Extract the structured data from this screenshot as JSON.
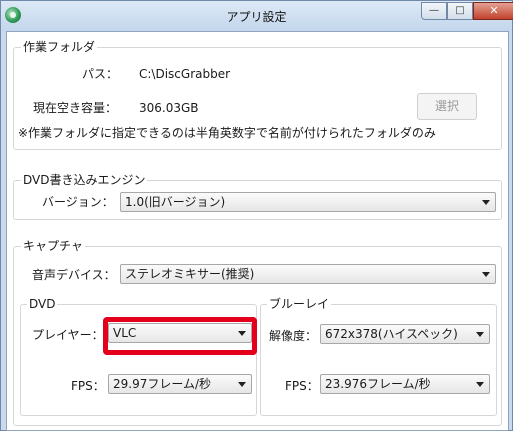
{
  "window": {
    "title": "アプリ設定",
    "min_label": "—",
    "max_label": "□",
    "close_label": "✕"
  },
  "work_folder": {
    "legend": "作業フォルダ",
    "path_label": "パス：",
    "path_value": "C:\\DiscGrabber",
    "space_label": "現在空き容量：",
    "space_value": "306.03GB",
    "select_button": "選択",
    "note": "※作業フォルダに指定できるのは半角英数字で名前が付けられたフォルダのみ"
  },
  "dvd_engine": {
    "legend": "DVD書き込みエンジン",
    "version_label": "バージョン：",
    "version_value": "1.0(旧バージョン)"
  },
  "capture": {
    "legend": "キャプチャ",
    "audio_label": "音声デバイス：",
    "audio_value": "ステレオミキサー(推奨)",
    "dvd": {
      "legend": "DVD",
      "player_label": "プレイヤー：",
      "player_value": "VLC",
      "fps_label": "FPS：",
      "fps_value": "29.97フレーム/秒"
    },
    "bluray": {
      "legend": "ブルーレイ",
      "resolution_label": "解像度：",
      "resolution_value": "672x378(ハイスペック)",
      "fps_label": "FPS：",
      "fps_value": "23.976フレーム/秒"
    }
  },
  "colors": {
    "highlight": "#e4001c",
    "close_button": "#c2422c"
  },
  "icons": {
    "app": "disc-grabber-app-icon",
    "dropdown": "chevron-down-icon"
  }
}
